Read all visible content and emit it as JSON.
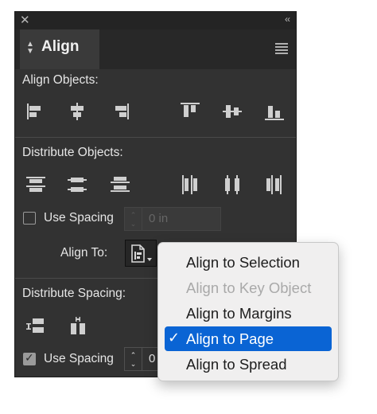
{
  "panel": {
    "title": "Align",
    "close_glyph": "✕",
    "collapse_glyph": "‹‹",
    "menu_icon": "panel-menu-icon"
  },
  "align_objects": {
    "heading": "Align Objects:",
    "icons": [
      "align-left-edges-icon",
      "align-horizontal-centers-icon",
      "align-right-edges-icon",
      "align-top-edges-icon",
      "align-vertical-centers-icon",
      "align-bottom-edges-icon"
    ]
  },
  "distribute_objects": {
    "heading": "Distribute Objects:",
    "icons": [
      "distribute-top-edges-icon",
      "distribute-vertical-centers-icon",
      "distribute-bottom-edges-icon",
      "distribute-left-edges-icon",
      "distribute-horizontal-centers-icon",
      "distribute-right-edges-icon"
    ],
    "use_spacing_label": "Use Spacing",
    "use_spacing_checked": false,
    "spacing_value": "0 in",
    "align_to_label": "Align To:"
  },
  "distribute_spacing": {
    "heading": "Distribute Spacing:",
    "icons": [
      "distribute-vertical-space-icon",
      "distribute-horizontal-space-icon"
    ],
    "use_spacing_label": "Use Spacing",
    "use_spacing_checked": true,
    "spacing_value": "0"
  },
  "align_to_menu": {
    "items": [
      {
        "label": "Align to Selection",
        "state": "normal"
      },
      {
        "label": "Align to Key Object",
        "state": "disabled"
      },
      {
        "label": "Align to Margins",
        "state": "normal"
      },
      {
        "label": "Align to Page",
        "state": "selected"
      },
      {
        "label": "Align to Spread",
        "state": "normal"
      }
    ],
    "check_glyph": "✓",
    "selected_color": "#0a64d4"
  }
}
